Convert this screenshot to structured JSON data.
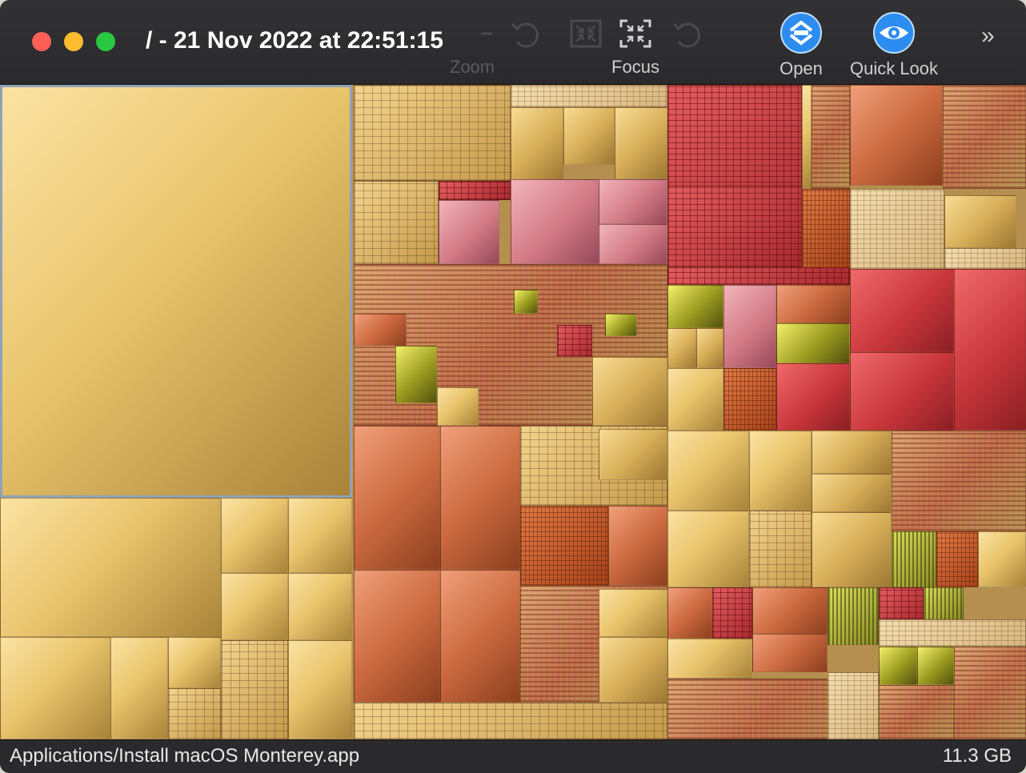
{
  "window": {
    "title": "/ - 21 Nov 2022 at 22:51:15"
  },
  "toolbar": {
    "zoom_label": "Zoom",
    "focus_label": "Focus",
    "open_label": "Open",
    "quick_look_label": "Quick Look",
    "overflow_glyph": "»"
  },
  "status": {
    "path": "Applications/Install macOS Monterey.app",
    "size": "11.3 GB"
  },
  "colors": {
    "traffic_close": "#ff5f57",
    "traffic_minimize": "#febc2e",
    "traffic_zoom": "#28c840",
    "accent_blue": "#2d8cf0"
  }
}
